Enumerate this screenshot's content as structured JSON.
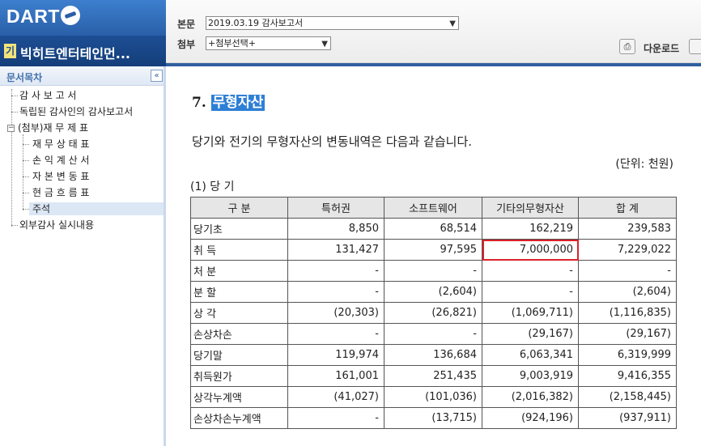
{
  "header": {
    "logo": "DART",
    "company_badge": "기",
    "company_name": "빅히트엔터테인먼...",
    "report_label": "본문",
    "report_select": "2019.03.19  감사보고서",
    "attach_label": "첨부",
    "attach_select": "+첨부선택+",
    "download_label": "다운로드"
  },
  "sidebar": {
    "title": "문서목차",
    "collapse": "«",
    "expand": "−",
    "items": [
      {
        "label": "감 사 보 고 서"
      },
      {
        "label": "독립된 감사인의 감사보고서"
      },
      {
        "label": "(첨부)재 무 제 표"
      },
      {
        "label": "재 무 상 태 표"
      },
      {
        "label": "손 익 계 산 서"
      },
      {
        "label": "자 본 변 동 표"
      },
      {
        "label": "현 금 흐 름 표"
      },
      {
        "label": "주석"
      },
      {
        "label": "외부감사 실시내용"
      }
    ]
  },
  "content": {
    "section_number": "7.",
    "section_title": "무형자산",
    "intro": "당기와 전기의 무형자산의 변동내역은 다음과 같습니다.",
    "unit": "(단위: 천원)",
    "subhead": "(1) 당 기",
    "table": {
      "headers": [
        "구   분",
        "특허권",
        "소프트웨어",
        "기타의무형자산",
        "합   계"
      ],
      "rows": [
        [
          "당기초",
          "8,850",
          "68,514",
          "162,219",
          "239,583"
        ],
        [
          "취   득",
          "131,427",
          "97,595",
          "7,000,000",
          "7,229,022"
        ],
        [
          "처   분",
          "-",
          "-",
          "-",
          "-"
        ],
        [
          "분   할",
          "-",
          "(2,604)",
          "-",
          "(2,604)"
        ],
        [
          "상   각",
          "(20,303)",
          "(26,821)",
          "(1,069,711)",
          "(1,116,835)"
        ],
        [
          "손상차손",
          "-",
          "-",
          "(29,167)",
          "(29,167)"
        ],
        [
          "당기말",
          "119,974",
          "136,684",
          "6,063,341",
          "6,319,999"
        ],
        [
          "취득원가",
          "161,001",
          "251,435",
          "9,003,919",
          "9,416,355"
        ],
        [
          "상각누계액",
          "(41,027)",
          "(101,036)",
          "(2,016,382)",
          "(2,158,445)"
        ],
        [
          "손상차손누계액",
          "-",
          "(13,715)",
          "(924,196)",
          "(937,911)"
        ]
      ]
    }
  },
  "colors": {
    "header_blue": "#2a5fa8",
    "title_highlight": "#2e7fd6",
    "emphasis_box": "#d9222a",
    "active_toc": "#dce7f5"
  }
}
